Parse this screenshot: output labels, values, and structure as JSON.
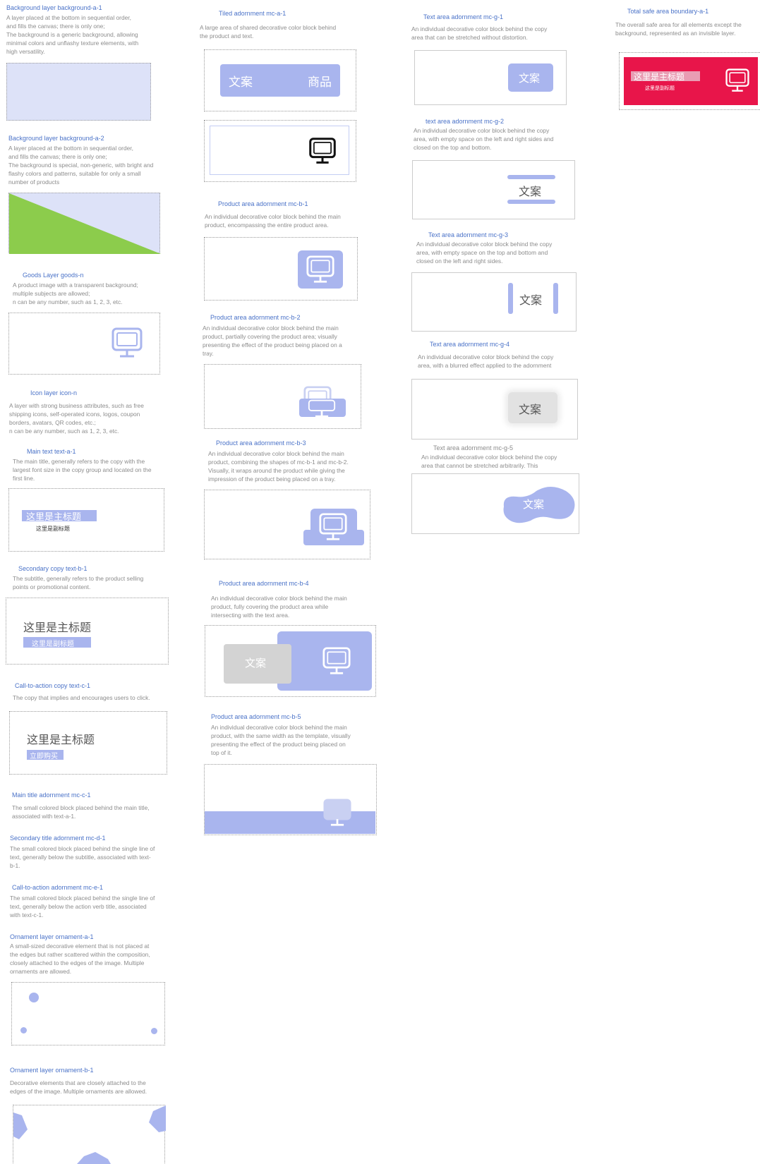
{
  "sections": {
    "bg_a1": {
      "title": "Background layer  background-a-1",
      "lines": [
        "A layer placed at the bottom in sequential order,",
        "and fills the canvas; there is only one;",
        "The background is a generic background, allowing",
        "minimal colors and unflashy texture elements, with",
        "high versatility."
      ]
    },
    "bg_a2": {
      "title": "Background layer  background-a-2",
      "lines": [
        "A layer placed at the bottom in sequential order,",
        "and fills the canvas; there is only one;",
        "The background is special, non-generic, with bright and",
        "flashy colors and patterns, suitable for only a small",
        "number of products"
      ]
    },
    "goods": {
      "title": "Goods Layer goods-n",
      "lines": [
        "A product image with a transparent background;",
        "multiple subjects are allowed;",
        "n can be any number, such as 1, 2, 3, etc."
      ]
    },
    "icon": {
      "title": "Icon layer icon-n",
      "lines": [
        "A layer with strong business attributes, such as free",
        "shipping icons, self-operated icons, logos, coupon",
        "borders, avatars, QR codes, etc.;",
        "n can be any number, such as 1, 2, 3, etc."
      ]
    },
    "text_a1": {
      "title": "Main text text-a-1",
      "lines": [
        "The main title, generally refers to the copy with the",
        "largest font size in the copy group and located on the",
        "first line."
      ]
    },
    "text_b1": {
      "title": "Secondary copy text-b-1",
      "lines": [
        "The subtitle, generally refers to the product selling",
        "points or promotional content."
      ]
    },
    "text_c1": {
      "title": "Call-to-action copy text-c-1",
      "lines": [
        "The copy that implies and encourages users to click."
      ]
    },
    "mc_c1": {
      "title": "Main title adornment mc-c-1",
      "lines": [
        "The small colored block placed behind the main title,",
        "associated with text-a-1."
      ]
    },
    "mc_d1": {
      "title": "Secondary title adornment mc-d-1",
      "lines": [
        "The small colored block placed behind the single line of",
        "text, generally below the subtitle, associated with text-",
        "b-1."
      ]
    },
    "mc_e1": {
      "title": "Call-to-action adornment mc-e-1",
      "lines": [
        "The small colored block placed behind the single line of",
        "text, generally below the action verb title, associated",
        "with text-c-1."
      ]
    },
    "orn_a1": {
      "title": "Ornament layer ornament-a-1",
      "lines": [
        "A small-sized decorative element that is not placed at",
        "the edges but rather scattered within the composition,",
        "closely attached to the edges of the image. Multiple",
        "ornaments are allowed."
      ]
    },
    "orn_b1": {
      "title": "Ornament layer ornament-b-1",
      "lines": [
        "Decorative elements that are closely attached to the",
        "edges of the image. Multiple ornaments are allowed."
      ]
    },
    "mc_a1": {
      "title": "Tiled adornment mc-a-1",
      "lines": [
        "A large area of shared decorative color block behind",
        "the product and text."
      ]
    },
    "mc_b1": {
      "title": "Product area adornment mc-b-1",
      "lines": [
        "An individual decorative color block behind the main",
        "product, encompassing the entire product area."
      ]
    },
    "mc_b2": {
      "title": "Product area adornment mc-b-2",
      "lines": [
        "An individual decorative color block behind the main",
        "product, partially covering the product area; visually",
        "presenting the effect of the product being placed on a",
        "tray."
      ]
    },
    "mc_b3": {
      "title": "Product area adornment mc-b-3",
      "lines": [
        "An individual decorative color block behind the main",
        "product, combining the shapes of mc-b-1 and mc-b-2.",
        "Visually, it wraps around the product while giving the",
        "impression of the product being placed on a tray."
      ]
    },
    "mc_b4": {
      "title": "Product area adornment mc-b-4",
      "lines": [
        "An individual decorative color block behind the main",
        "product, fully covering the product area while",
        "intersecting with the text area."
      ]
    },
    "mc_b5": {
      "title": "Product area adornment mc-b-5",
      "lines": [
        "An individual decorative color block behind the main",
        "product, with the same width as the template, visually",
        "presenting the effect of the product being placed on",
        "top of it."
      ]
    },
    "mc_g1": {
      "title": "Text area adornment mc-g-1",
      "lines": [
        "An individual decorative color block behind the copy",
        "area that can be stretched without distortion."
      ]
    },
    "mc_g2": {
      "title": "text area adornment mc-g-2",
      "lines": [
        "An individual decorative color block behind the copy",
        "area, with empty space on the left and right sides and",
        "closed on the top and bottom."
      ]
    },
    "mc_g3": {
      "title": "Text area adornment mc-g-3",
      "lines": [
        "An individual decorative color block behind the copy",
        "area, with empty space on the top and bottom and",
        "closed on the left and right sides."
      ]
    },
    "mc_g4": {
      "title": "Text area adornment mc-g-4",
      "lines": [
        "An individual decorative color block behind the copy",
        "area, with a blurred effect applied to the adornment"
      ]
    },
    "mc_g5": {
      "title": "Text area adornment mc-g-5",
      "lines": [
        "An individual decorative color block behind the copy",
        "area that cannot be stretched arbitrarily. This"
      ]
    },
    "safe": {
      "title": "Total safe area boundary-a-1",
      "lines": [
        "The overall safe area for all elements except the",
        "background, represented as an invisible layer."
      ]
    }
  },
  "sample_text": {
    "main_title": "这里是主标题",
    "subtitle": "这里是副标题",
    "cta": "立即购买",
    "copy": "文案",
    "goods": "商品"
  },
  "colors": {
    "accent": "#a9b5ee",
    "green": "#8ccc4c",
    "red": "#e8154a",
    "title_blue": "#4a72c8"
  },
  "icons": [
    "monitor-icon"
  ]
}
